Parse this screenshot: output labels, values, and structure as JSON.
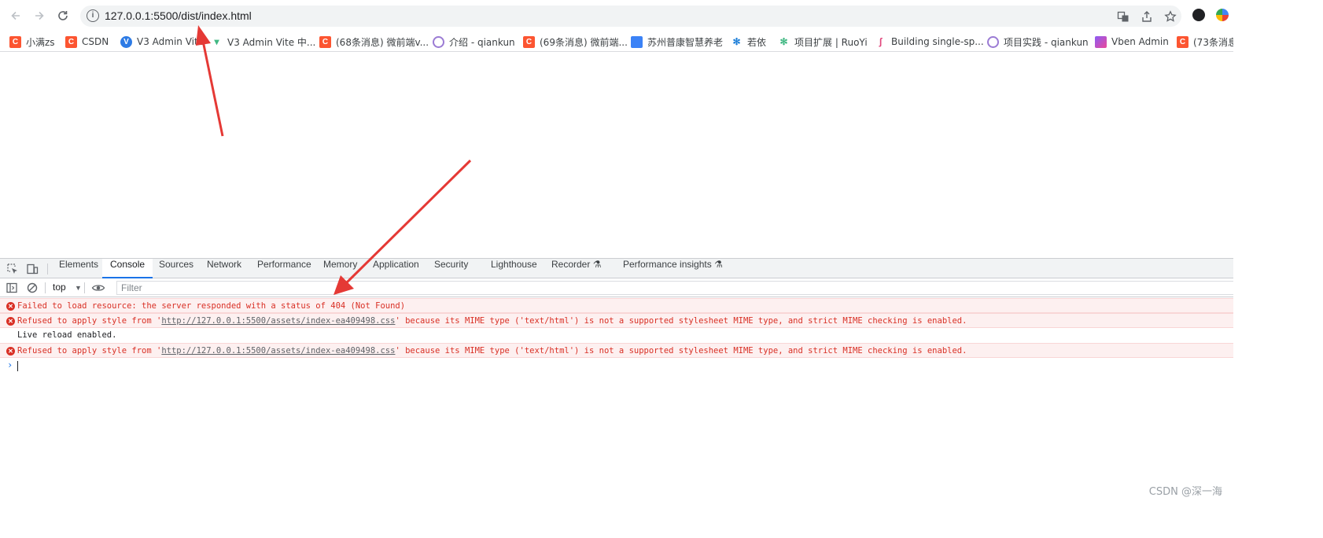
{
  "browser": {
    "url": "127.0.0.1:5500/dist/index.html",
    "nav": {
      "back_icon": "back-arrow-icon",
      "forward_icon": "forward-arrow-icon",
      "reload_icon": "reload-icon"
    }
  },
  "bookmarks": [
    {
      "label": "小满zs",
      "icon": "csdn-icon"
    },
    {
      "label": "CSDN",
      "icon": "csdn-icon"
    },
    {
      "label": "V3 Admin Vite",
      "icon": "vite-icon"
    },
    {
      "label": "V3 Admin Vite 中...",
      "icon": "vue-icon"
    },
    {
      "label": "(68条消息) 微前端v...",
      "icon": "csdn-icon"
    },
    {
      "label": "介绍 - qiankun",
      "icon": "qiankun-icon"
    },
    {
      "label": "(69条消息) 微前端...",
      "icon": "csdn-icon"
    },
    {
      "label": "苏州普康智慧养老",
      "icon": "site-icon"
    },
    {
      "label": "若依",
      "icon": "ruoyi-icon"
    },
    {
      "label": "项目扩展 | RuoYi",
      "icon": "ruoyi-icon"
    },
    {
      "label": "Building single-sp...",
      "icon": "singlespa-icon"
    },
    {
      "label": "项目实践 - qiankun",
      "icon": "qiankun-icon"
    },
    {
      "label": "Vben Admin",
      "icon": "vben-icon"
    },
    {
      "label": "(73条消息",
      "icon": "csdn-icon"
    }
  ],
  "devtools": {
    "tabs": [
      "Elements",
      "Console",
      "Sources",
      "Network",
      "Performance",
      "Memory",
      "Application",
      "Security",
      "Lighthouse",
      "Recorder",
      "Performance insights"
    ],
    "active_tab": "Console",
    "context": "top",
    "filter_placeholder": "Filter",
    "messages": [
      {
        "level": "error",
        "text": "Failed to load resource: the server responded with a status of 404 (Not Found)"
      },
      {
        "level": "error",
        "prefix": "Refused to apply style from '",
        "link": "http://127.0.0.1:5500/assets/index-ea409498.css",
        "suffix": "' because its MIME type ('text/html') is not a supported stylesheet MIME type, and strict MIME checking is enabled."
      },
      {
        "level": "info",
        "text": "Live reload enabled."
      },
      {
        "level": "error",
        "prefix": "Refused to apply style from '",
        "link": "http://127.0.0.1:5500/assets/index-ea409498.css",
        "suffix": "' because its MIME type ('text/html') is not a supported stylesheet MIME type, and strict MIME checking is enabled."
      }
    ],
    "prompt": "›"
  },
  "watermark": "CSDN @深一海",
  "colors": {
    "error": "#d93025",
    "error_bg": "#fdf0f0",
    "arrow": "#e53935",
    "accent": "#1a73e8"
  }
}
